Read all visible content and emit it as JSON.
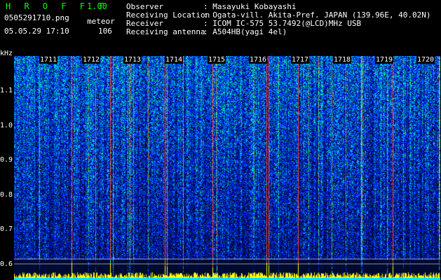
{
  "header": {
    "app_name": "H R O F F T",
    "version": "1.00",
    "filename": "0505291710.png",
    "mode": "meteor",
    "datetime": "05.05.29 17:10",
    "count": "106"
  },
  "info": [
    {
      "label": "Observer",
      "value": ": Masayuki Kobayashi"
    },
    {
      "label": "Receiving Location",
      "value": ": Ogata-vill. Akita-Pref. JAPAN (139.96E, 40.02N)"
    },
    {
      "label": "Receiver",
      "value": ": ICOM IC-575 53.7492(@LCD)MHz USB"
    },
    {
      "label": "Receiving antenna",
      "value": ": A504HB(yagi 4el)"
    }
  ],
  "spectrogram": {
    "y_unit": "kHz",
    "y_ticks": [
      "1.1",
      "1.0",
      "0.9",
      "0.8",
      "0.7",
      "0.6"
    ],
    "x_ticks": [
      "1711",
      "1712",
      "1713",
      "1714",
      "1715",
      "1716",
      "1717",
      "1718",
      "1719",
      "1720"
    ],
    "colors": {
      "noise_low": "#00103a",
      "noise_mid": "#0050ff",
      "signal_mid": "#00e0ff",
      "signal_high": "#40ff40",
      "peak": "#ff3030",
      "level_trace": "#ffff00",
      "ref_line": "#ffffff"
    }
  }
}
